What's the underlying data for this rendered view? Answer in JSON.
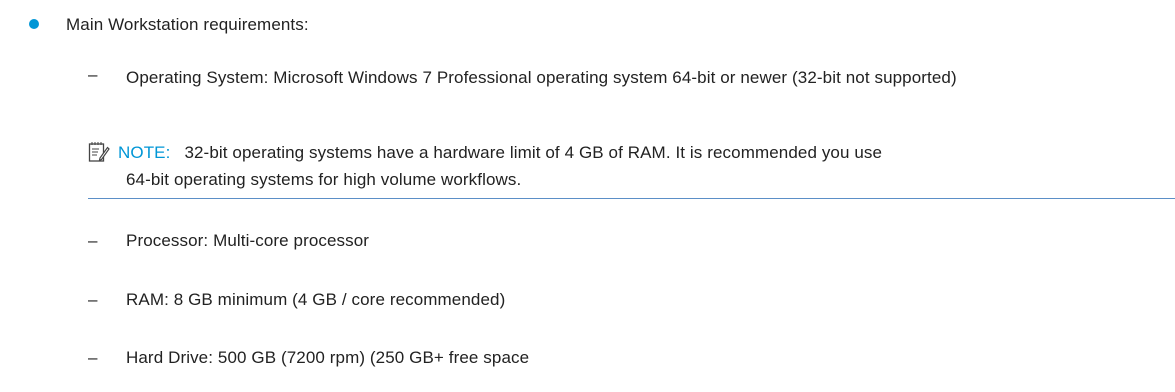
{
  "colors": {
    "accent": "#0096d6",
    "note_rule": "#5b8fc7",
    "text": "#222222"
  },
  "main_item": {
    "text": "Main Workstation requirements:"
  },
  "sub_items": [
    {
      "dash": "–",
      "text": "Operating System: Microsoft Windows 7 Professional operating system 64-bit or newer (32-bit not supported)"
    },
    {
      "dash": "–",
      "text": "Processor: Multi-core processor"
    },
    {
      "dash": "–",
      "text": "RAM: 8 GB minimum (4 GB / core recommended)"
    },
    {
      "dash": "–",
      "text": "Hard Drive: 500 GB (7200 rpm) (250 GB+ free space"
    }
  ],
  "note": {
    "icon": "note-pencil-icon",
    "label": "NOTE:",
    "text_line1": "32-bit operating systems have a hardware limit of 4 GB of RAM. It is recommended you use",
    "text_line2": "64-bit operating systems for high volume workflows."
  }
}
